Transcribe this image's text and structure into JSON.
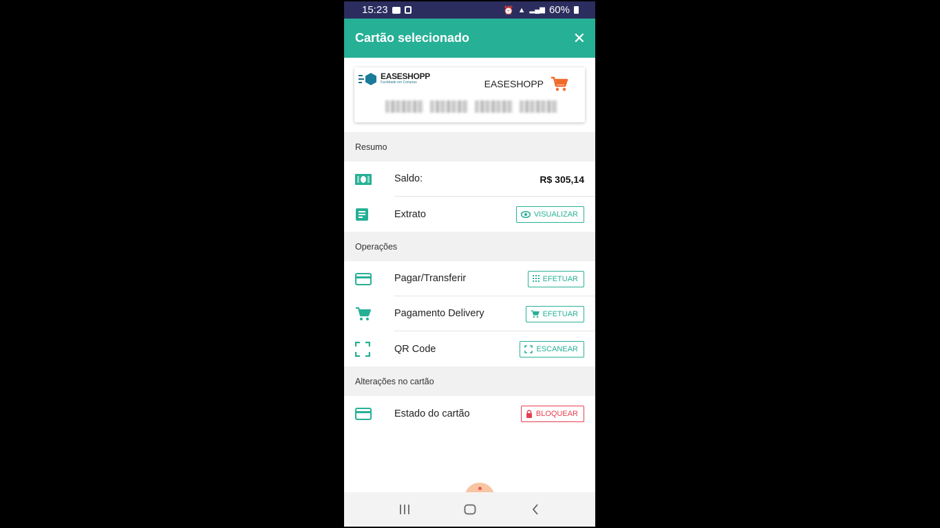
{
  "status_bar": {
    "time": "15:23",
    "battery": "60%"
  },
  "appbar": {
    "title": "Cartão selecionado",
    "close_glyph": "✕"
  },
  "card": {
    "logo_name": "EASESHOPP",
    "logo_tagline": "Facilidade em Compras",
    "brand_name": "EASESHOPP"
  },
  "sections": {
    "resumo": "Resumo",
    "operacoes": "Operações",
    "alteracoes": "Alterações no cartão"
  },
  "rows": {
    "saldo": {
      "label": "Saldo:",
      "value": "R$ 305,14",
      "icon": "money-icon"
    },
    "extrato": {
      "label": "Extrato",
      "button": "VISUALIZAR",
      "icon": "document-icon"
    },
    "pagar": {
      "label": "Pagar/Transferir",
      "button": "EFETUAR",
      "icon": "credit-card-icon"
    },
    "delivery": {
      "label": "Pagamento Delivery",
      "button": "EFETUAR",
      "icon": "cart-icon"
    },
    "qrcode": {
      "label": "QR Code",
      "button": "ESCANEAR",
      "icon": "scan-icon"
    },
    "estado": {
      "label": "Estado do cartão",
      "button": "BLOQUEAR",
      "icon": "credit-card-icon"
    }
  },
  "colors": {
    "accent": "#26b096",
    "danger": "#e53e4e",
    "statusbar": "#2b2d5e"
  }
}
